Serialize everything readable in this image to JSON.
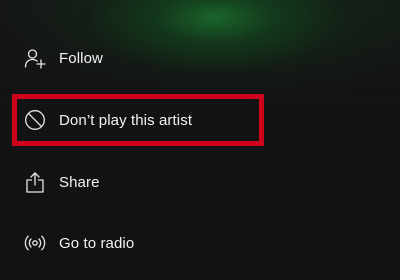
{
  "menu": {
    "items": [
      {
        "label": "Follow",
        "icon": "add-user-icon"
      },
      {
        "label": "Don’t play this artist",
        "icon": "block-icon"
      },
      {
        "label": "Share",
        "icon": "share-icon"
      },
      {
        "label": "Go to radio",
        "icon": "radio-icon"
      }
    ]
  },
  "highlight": {
    "color": "#d0021b",
    "target": "Don’t play this artist"
  },
  "colors": {
    "background": "#121212",
    "text": "#f2f2f2",
    "accent_glow": "#1c7830"
  }
}
